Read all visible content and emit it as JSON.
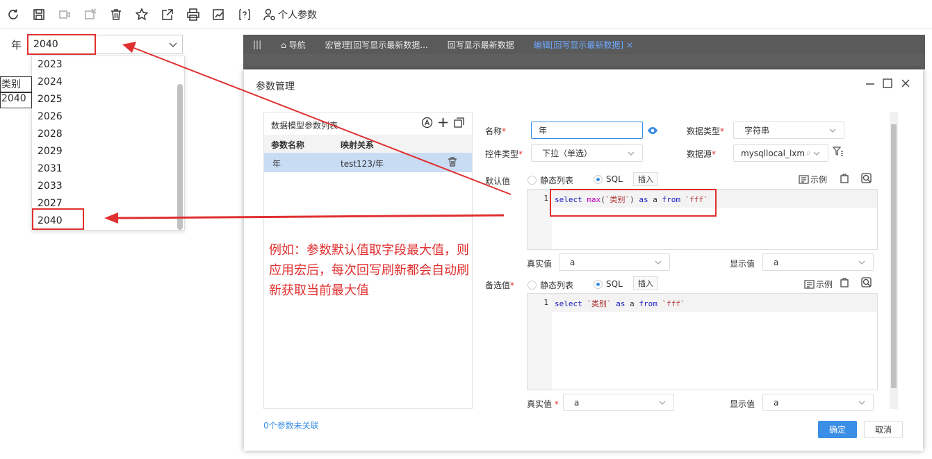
{
  "toolbar": {
    "icons": [
      "refresh-icon",
      "save-icon",
      "video-icon",
      "cancel-edit-icon",
      "delete-icon",
      "star-icon",
      "share-icon",
      "print-icon",
      "chart-export-icon",
      "help-icon"
    ],
    "personal_label": "个人参数"
  },
  "param": {
    "label": "年",
    "value": "2040",
    "options": [
      "2023",
      "2024",
      "2025",
      "2026",
      "2028",
      "2029",
      "2031",
      "2033",
      "2027",
      "2040"
    ]
  },
  "report": {
    "header": "类别",
    "value": "2040"
  },
  "editor_tabs": [
    "导航",
    "宏管理[回写显示最新数据...",
    "回写显示最新数据",
    "编辑[回写显示最新数据]"
  ],
  "modal": {
    "title": "参数管理",
    "left": {
      "heading": "数据模型参数列表",
      "col_name": "参数名称",
      "col_map": "映射关系",
      "row_name": "年",
      "row_map": "test123/年"
    },
    "unlinked": "0个参数未关联",
    "name_label": "名称",
    "name_value": "年",
    "datatype_label": "数据类型",
    "datatype_value": "字符串",
    "control_label": "控件类型",
    "control_value": "下拉（单选）",
    "source_label": "数据源",
    "source_value": "mysqllocal_lxm",
    "default_label": "默认值",
    "static_list": "静态列表",
    "sql": "SQL",
    "insert": "插入",
    "sample": "示例",
    "default_sql": {
      "line_no": "1",
      "p1": "select ",
      "p2": "max",
      "p3": "(",
      "p4": "`类别`",
      "p5": ") ",
      "p6": "as",
      "p7": " a ",
      "p8": "from",
      "p9": " ",
      "p10": "`fff`"
    },
    "real_label": "真实值",
    "real_value": "a",
    "display_label": "显示值",
    "display_value": "a",
    "options_label": "备选值",
    "options_sql": {
      "line_no": "1",
      "p1": "select ",
      "p2": "`类别`",
      "p3": " ",
      "p4": "as",
      "p5": " a ",
      "p6": "from",
      "p7": " ",
      "p8": "`fff`"
    },
    "real_label2": "真实值",
    "real_value2": "a",
    "display_label2": "显示值",
    "display_value2": "a",
    "ok": "确定",
    "cancel": "取消"
  },
  "note": "例如：参数默认值取字段最大值，则应用宏后，每次回写刷新都会自动刷新获取当前最大值",
  "colors": {
    "accent": "#3a8ee6",
    "annotation": "#e03030",
    "selected_row": "#c8dcf4"
  }
}
